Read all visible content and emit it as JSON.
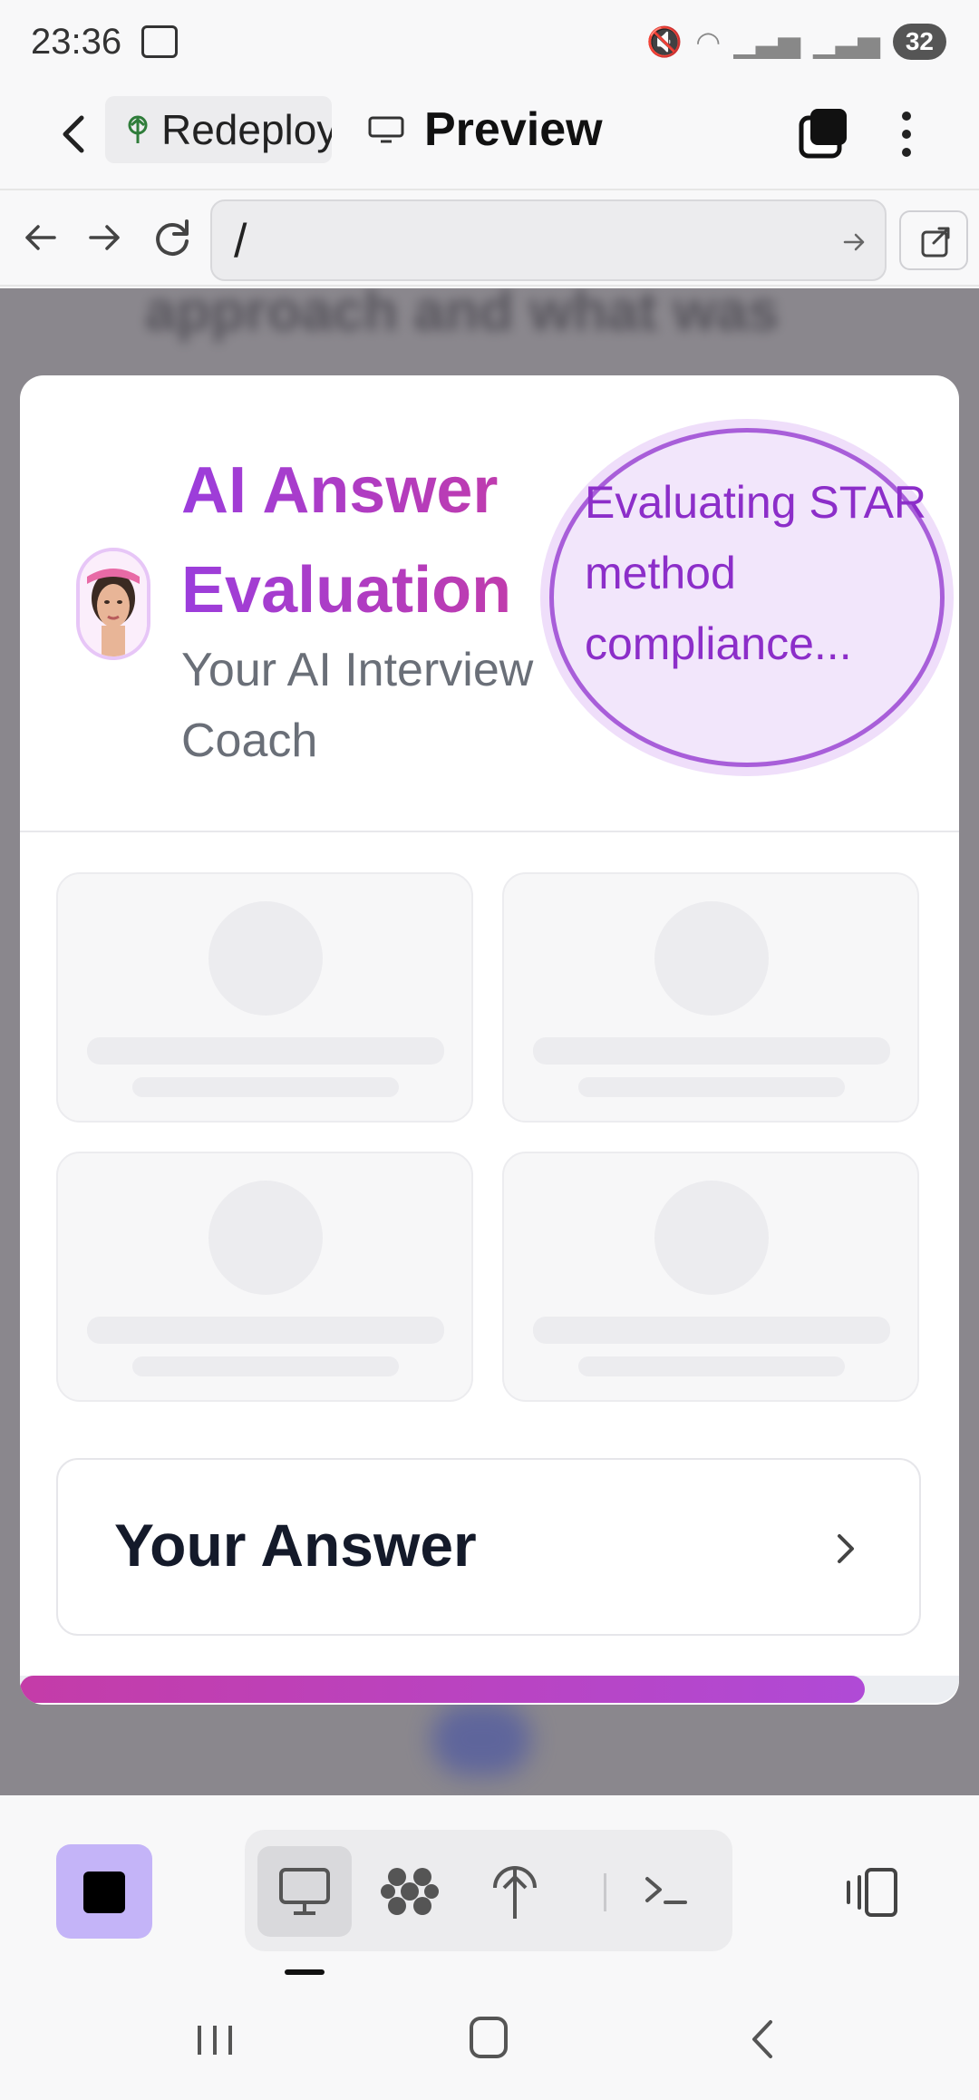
{
  "status_bar": {
    "time": "23:36",
    "battery": "32"
  },
  "header": {
    "back_icon": "chevron-left-icon",
    "project_name": "Redeploy",
    "preview_label": "Preview"
  },
  "url_bar": {
    "value": "/"
  },
  "modal": {
    "title": "AI Answer Evaluation",
    "subtitle": "Your AI Interview Coach",
    "status_text": "Evaluating STAR method compliance...",
    "answer_label": "Your Answer",
    "progress_fraction": 0.9
  },
  "colors": {
    "accent_purple": "#9b3ddc",
    "accent_pink": "#c43ca8",
    "stop_button": "#c4b4f8"
  },
  "toolbar": {
    "icons": [
      "stop-icon",
      "monitor-icon",
      "grid-icon",
      "deploy-icon",
      "terminal-icon",
      "device-switch-icon"
    ]
  }
}
